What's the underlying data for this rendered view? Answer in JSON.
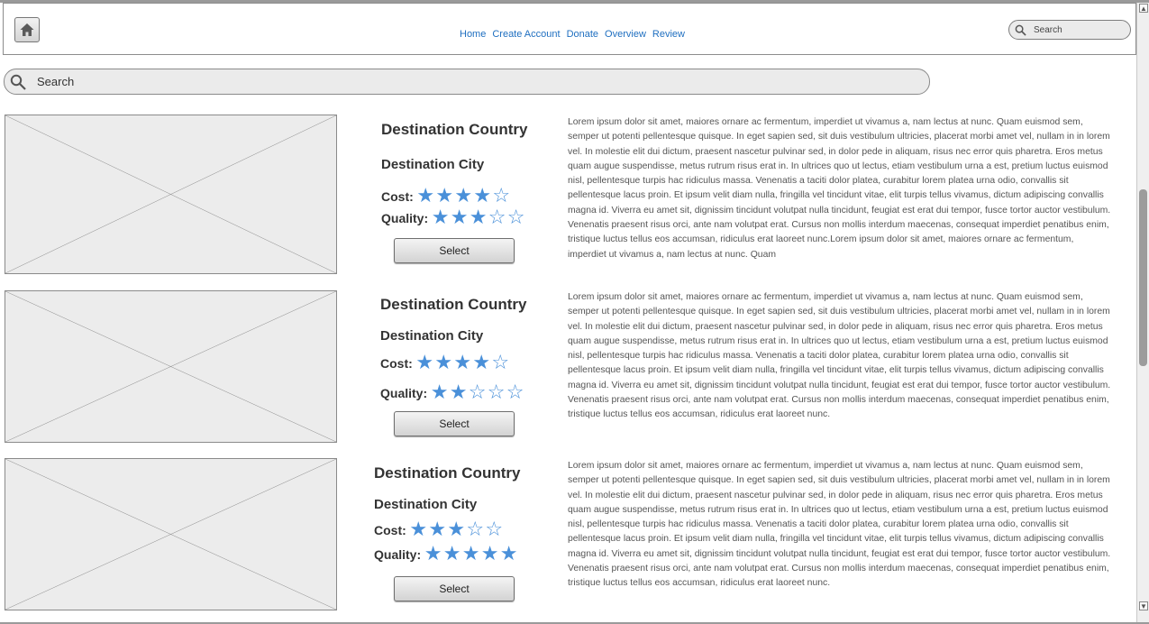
{
  "header": {
    "home_icon": "home-icon",
    "nav": [
      "Home",
      "Create Account",
      "Donate",
      "Overview",
      "Review"
    ],
    "search_placeholder": "Search"
  },
  "main_search": {
    "placeholder": "Search"
  },
  "cards": [
    {
      "country": "Destination Country",
      "city": "Destination City",
      "cost_label": "Cost:",
      "cost_rating": 4,
      "quality_label": "Quality:",
      "quality_rating": 3,
      "button": "Select",
      "description": "Lorem ipsum dolor sit amet, maiores ornare ac fermentum, imperdiet ut vivamus a, nam lectus at nunc. Quam euismod sem, semper ut potenti pellentesque quisque. In eget sapien sed, sit duis vestibulum ultricies, placerat morbi amet vel, nullam in in lorem vel. In molestie elit dui dictum, praesent nascetur pulvinar sed, in dolor pede in aliquam, risus nec error quis pharetra. Eros metus quam augue suspendisse, metus rutrum risus erat in.  In ultrices quo ut lectus, etiam vestibulum urna a est, pretium luctus euismod nisl, pellentesque turpis hac ridiculus massa. Venenatis a taciti dolor platea, curabitur lorem platea urna odio, convallis sit pellentesque lacus proin. Et ipsum velit diam nulla, fringilla vel tincidunt vitae, elit turpis tellus vivamus, dictum adipiscing convallis magna id. Viverra eu amet sit, dignissim tincidunt volutpat nulla tincidunt, feugiat est erat dui tempor, fusce tortor auctor vestibulum. Venenatis praesent risus orci, ante nam volutpat erat. Cursus non mollis interdum maecenas, consequat imperdiet penatibus enim, tristique luctus tellus eos accumsan, ridiculus erat laoreet nunc.Lorem ipsum dolor sit amet, maiores ornare ac fermentum, imperdiet ut vivamus a, nam lectus at nunc. Quam"
    },
    {
      "country": "Destination Country",
      "city": "Destination City",
      "cost_label": "Cost:",
      "cost_rating": 4,
      "quality_label": "Quality:",
      "quality_rating": 2,
      "button": "Select",
      "description": "Lorem ipsum dolor sit amet, maiores ornare ac fermentum, imperdiet ut vivamus a, nam lectus at nunc. Quam euismod sem, semper ut potenti pellentesque quisque. In eget sapien sed, sit duis vestibulum ultricies, placerat morbi amet vel, nullam in in lorem vel. In molestie elit dui dictum, praesent nascetur pulvinar sed, in dolor pede in aliquam, risus nec error quis pharetra. Eros metus quam augue suspendisse, metus rutrum risus erat in.  In ultrices quo ut lectus, etiam vestibulum urna a est, pretium luctus euismod nisl, pellentesque turpis hac ridiculus massa. Venenatis a taciti dolor platea, curabitur lorem platea urna odio, convallis sit pellentesque lacus proin. Et ipsum velit diam nulla, fringilla vel tincidunt vitae, elit turpis tellus vivamus, dictum adipiscing convallis magna id. Viverra eu amet sit, dignissim tincidunt volutpat nulla tincidunt, feugiat est erat dui tempor, fusce tortor auctor vestibulum. Venenatis praesent risus orci, ante nam volutpat erat. Cursus non mollis interdum maecenas, consequat imperdiet penatibus enim, tristique luctus tellus eos accumsan, ridiculus erat laoreet nunc."
    },
    {
      "country": "Destination Country",
      "city": "Destination City",
      "cost_label": "Cost:",
      "cost_rating": 3,
      "quality_label": "Quality:",
      "quality_rating": 5,
      "button": "Select",
      "description": "Lorem ipsum dolor sit amet, maiores ornare ac fermentum, imperdiet ut vivamus a, nam lectus at nunc. Quam euismod sem, semper ut potenti pellentesque quisque. In eget sapien sed, sit duis vestibulum ultricies, placerat morbi amet vel, nullam in in lorem vel. In molestie elit dui dictum, praesent nascetur pulvinar sed, in dolor pede in aliquam, risus nec error quis pharetra. Eros metus quam augue suspendisse, metus rutrum risus erat in.  In ultrices quo ut lectus, etiam vestibulum urna a est, pretium luctus euismod nisl, pellentesque turpis hac ridiculus massa. Venenatis a taciti dolor platea, curabitur lorem platea urna odio, convallis sit pellentesque lacus proin. Et ipsum velit diam nulla, fringilla vel tincidunt vitae, elit turpis tellus vivamus, dictum adipiscing convallis magna id. Viverra eu amet sit, dignissim tincidunt volutpat nulla tincidunt, feugiat est erat dui tempor, fusce tortor auctor vestibulum. Venenatis praesent risus orci, ante nam volutpat erat. Cursus non mollis interdum maecenas, consequat imperdiet penatibus enim, tristique luctus tellus eos accumsan, ridiculus erat laoreet nunc."
    }
  ],
  "colors": {
    "star": "#4a90d9",
    "link": "#1f6fc0"
  }
}
